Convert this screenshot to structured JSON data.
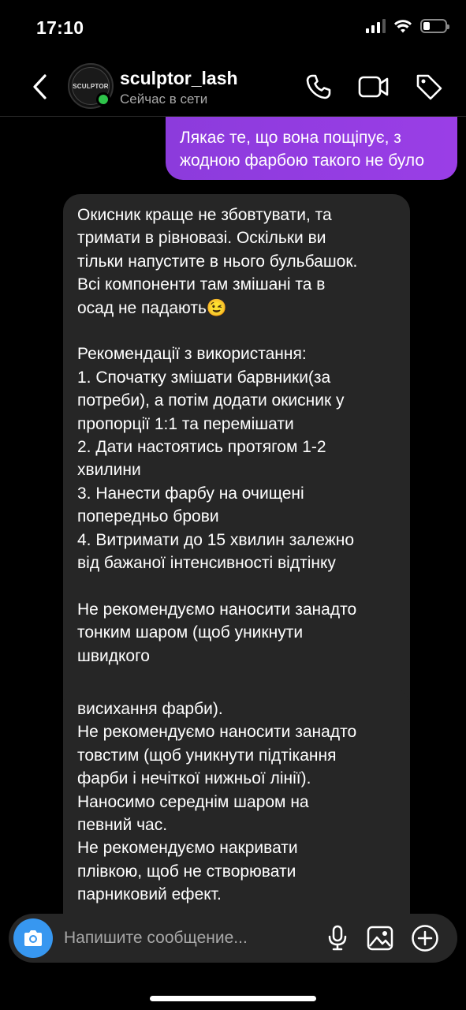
{
  "status_bar": {
    "time": "17:10"
  },
  "header": {
    "back_icon": "chevron-left-icon",
    "avatar_text": "SCULPTOR",
    "name": "sculptor_lash",
    "status": "Сейчас в сети",
    "icons": [
      "phone-icon",
      "video-camera-icon",
      "tag-icon"
    ],
    "online_color": "#2ec44a"
  },
  "messages": [
    {
      "direction": "outgoing",
      "text": "Лякає те, що вона пощіпує, з\nжодною фарбою такого не було"
    },
    {
      "direction": "incoming",
      "text": "Окисник краще не збовтувати, та\nтримати в рівновазі. Оскільки ви\nтільки напустите в нього бульбашок.\nВсі компоненти там змішані та в\nосад не падають😉\n\nРекомендації з використання:\n1. Спочатку змішати барвники(за\nпотреби), а потім додати окисник у\nпропорції 1:1 та перемішати\n2. Дати настоятись протягом 1-2\nхвилини\n3. Нанести фарбу на очищені\nпопередньо брови\n4. Витримати до 15 хвилин залежно\nвід бажаної інтенсивності відтінку\n\nНе рекомендуємо наносити занадто\nтонким шаром (щоб уникнути\nшвидкого"
    },
    {
      "direction": "incoming",
      "text": "висихання фарби).\nНе рекомендуємо наносити занадто\nтовстим (щоб уникнути підтікання\nфарби і нечіткої нижньої лінії).\nНаносимо середнім шаром на\nпевний час.\nНе рекомендуємо накривати\nплівкою, щоб не створювати\nпарниковий ефект."
    }
  ],
  "composer": {
    "placeholder": "Напишите сообщение...",
    "icons": [
      "camera-icon",
      "microphone-icon",
      "image-icon",
      "plus-circle-icon"
    ],
    "camera_color": "#3797f0"
  },
  "colors": {
    "background": "#000000",
    "incoming_bubble": "#262626",
    "outgoing_bubble": "#9a3ee6"
  }
}
